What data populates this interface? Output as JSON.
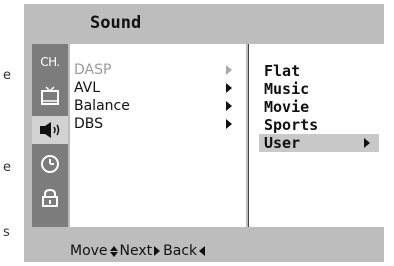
{
  "stray_chars": {
    "top": "e",
    "middle": "e",
    "bottom": "s"
  },
  "window": {
    "title": "Sound"
  },
  "sidebar": {
    "items": [
      {
        "icon": "channel-icon",
        "text": "CH."
      },
      {
        "icon": "tv-icon"
      },
      {
        "icon": "speaker-icon",
        "active": true
      },
      {
        "icon": "clock-icon"
      },
      {
        "icon": "lock-icon"
      }
    ]
  },
  "menu": {
    "items": [
      {
        "label": "DASP",
        "disabled": true
      },
      {
        "label": "AVL"
      },
      {
        "label": "Balance"
      },
      {
        "label": "DBS"
      }
    ]
  },
  "options": {
    "items": [
      {
        "label": "Flat"
      },
      {
        "label": "Music"
      },
      {
        "label": "Movie"
      },
      {
        "label": "Sports"
      },
      {
        "label": "User",
        "selected": true
      }
    ]
  },
  "footer": {
    "move": "Move",
    "next": "Next",
    "back": "Back"
  }
}
